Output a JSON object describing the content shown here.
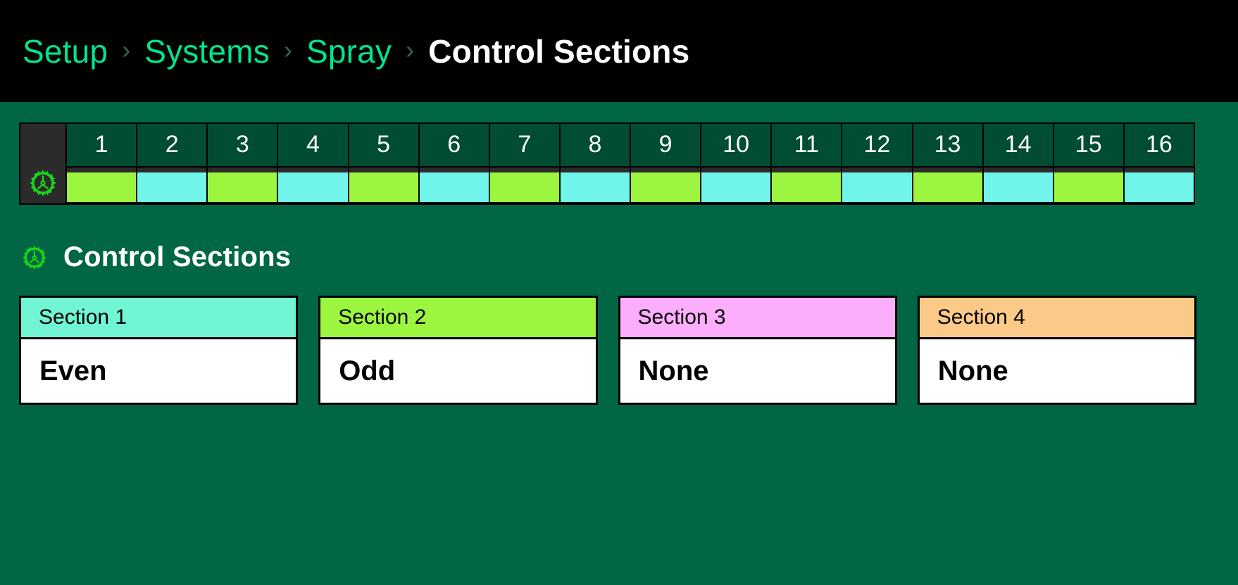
{
  "breadcrumb": {
    "separator": "›",
    "items": [
      {
        "label": "Setup",
        "current": false
      },
      {
        "label": "Systems",
        "current": false
      },
      {
        "label": "Spray",
        "current": false
      },
      {
        "label": "Control Sections",
        "current": true
      }
    ]
  },
  "nozzle_strip": {
    "gear_icon": "gear-icon",
    "columns": [
      {
        "number": "1",
        "color": "#9cf53f"
      },
      {
        "number": "2",
        "color": "#71f5ea"
      },
      {
        "number": "3",
        "color": "#9cf53f"
      },
      {
        "number": "4",
        "color": "#71f5ea"
      },
      {
        "number": "5",
        "color": "#9cf53f"
      },
      {
        "number": "6",
        "color": "#71f5ea"
      },
      {
        "number": "7",
        "color": "#9cf53f"
      },
      {
        "number": "8",
        "color": "#71f5ea"
      },
      {
        "number": "9",
        "color": "#9cf53f"
      },
      {
        "number": "10",
        "color": "#71f5ea"
      },
      {
        "number": "11",
        "color": "#9cf53f"
      },
      {
        "number": "12",
        "color": "#71f5ea"
      },
      {
        "number": "13",
        "color": "#9cf53f"
      },
      {
        "number": "14",
        "color": "#71f5ea"
      },
      {
        "number": "15",
        "color": "#9cf53f"
      },
      {
        "number": "16",
        "color": "#71f5ea"
      }
    ]
  },
  "section_heading": {
    "icon": "gear-icon",
    "title": "Control Sections"
  },
  "sections": [
    {
      "title": "Section 1",
      "value": "Even",
      "header_color": "#71f5d4"
    },
    {
      "title": "Section 2",
      "value": "Odd",
      "header_color": "#9cf53f"
    },
    {
      "title": "Section 3",
      "value": "None",
      "header_color": "#fbaefb"
    },
    {
      "title": "Section 4",
      "value": "None",
      "header_color": "#fbc988"
    }
  ],
  "colors": {
    "page_background": "#006644",
    "topbar_background": "#000000",
    "accent_green": "#00e58c",
    "icon_green": "#19d719",
    "strip_frame": "#2b2b2b",
    "strip_number_cell": "#004d33"
  }
}
